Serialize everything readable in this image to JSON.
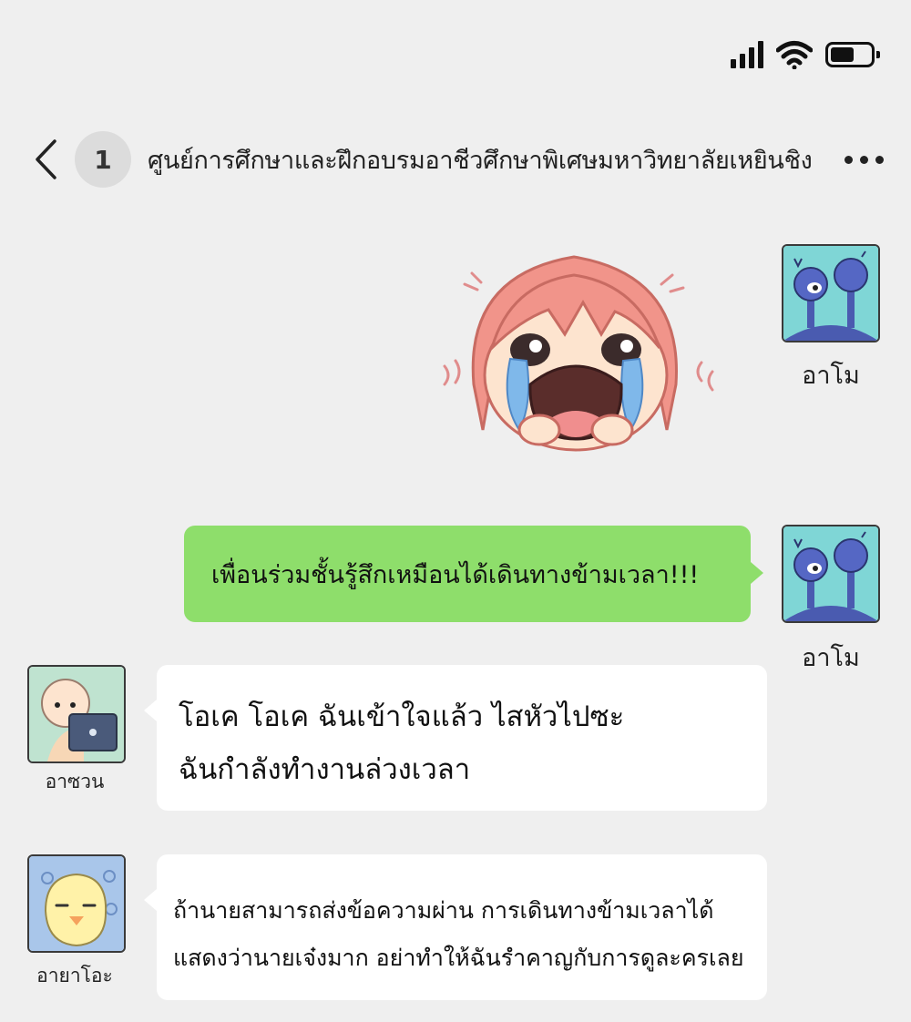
{
  "status_bar": {
    "battery_level": 0.6
  },
  "header": {
    "unread_count": "1",
    "title": "ศูนย์การศึกษาและฝึกอบรมอาชีวศึกษาพิเศษมหาวิทยาลัยเหยินชิง"
  },
  "messages": [
    {
      "sender": "อาโม",
      "side": "right",
      "type": "sticker",
      "sticker": "crying-girl-sticker"
    },
    {
      "sender": "อาโม",
      "side": "right",
      "type": "text",
      "text": "เพื่อนร่วมชั้นรู้สึกเหมือนได้เดินทางข้ามเวลา!!!"
    },
    {
      "sender": "อาซวน",
      "side": "left",
      "type": "text",
      "lines": [
        "โอเค โอเค ฉันเข้าใจแล้ว ไสหัวไปซะ",
        "ฉันกำลังทำงานล่วงเวลา"
      ]
    },
    {
      "sender": "อายาโอะ",
      "side": "left",
      "type": "text",
      "lines": [
        "ถ้านายสามารถส่งข้อความผ่าน การเดินทางข้ามเวลาได้",
        "แสดงว่านายเจ๋งมาก อย่าทำให้ฉันรำคาญกับการดูละครเลย"
      ]
    }
  ],
  "colors": {
    "background": "#efefef",
    "sent_bubble": "#8ede6b",
    "received_bubble": "#ffffff"
  }
}
